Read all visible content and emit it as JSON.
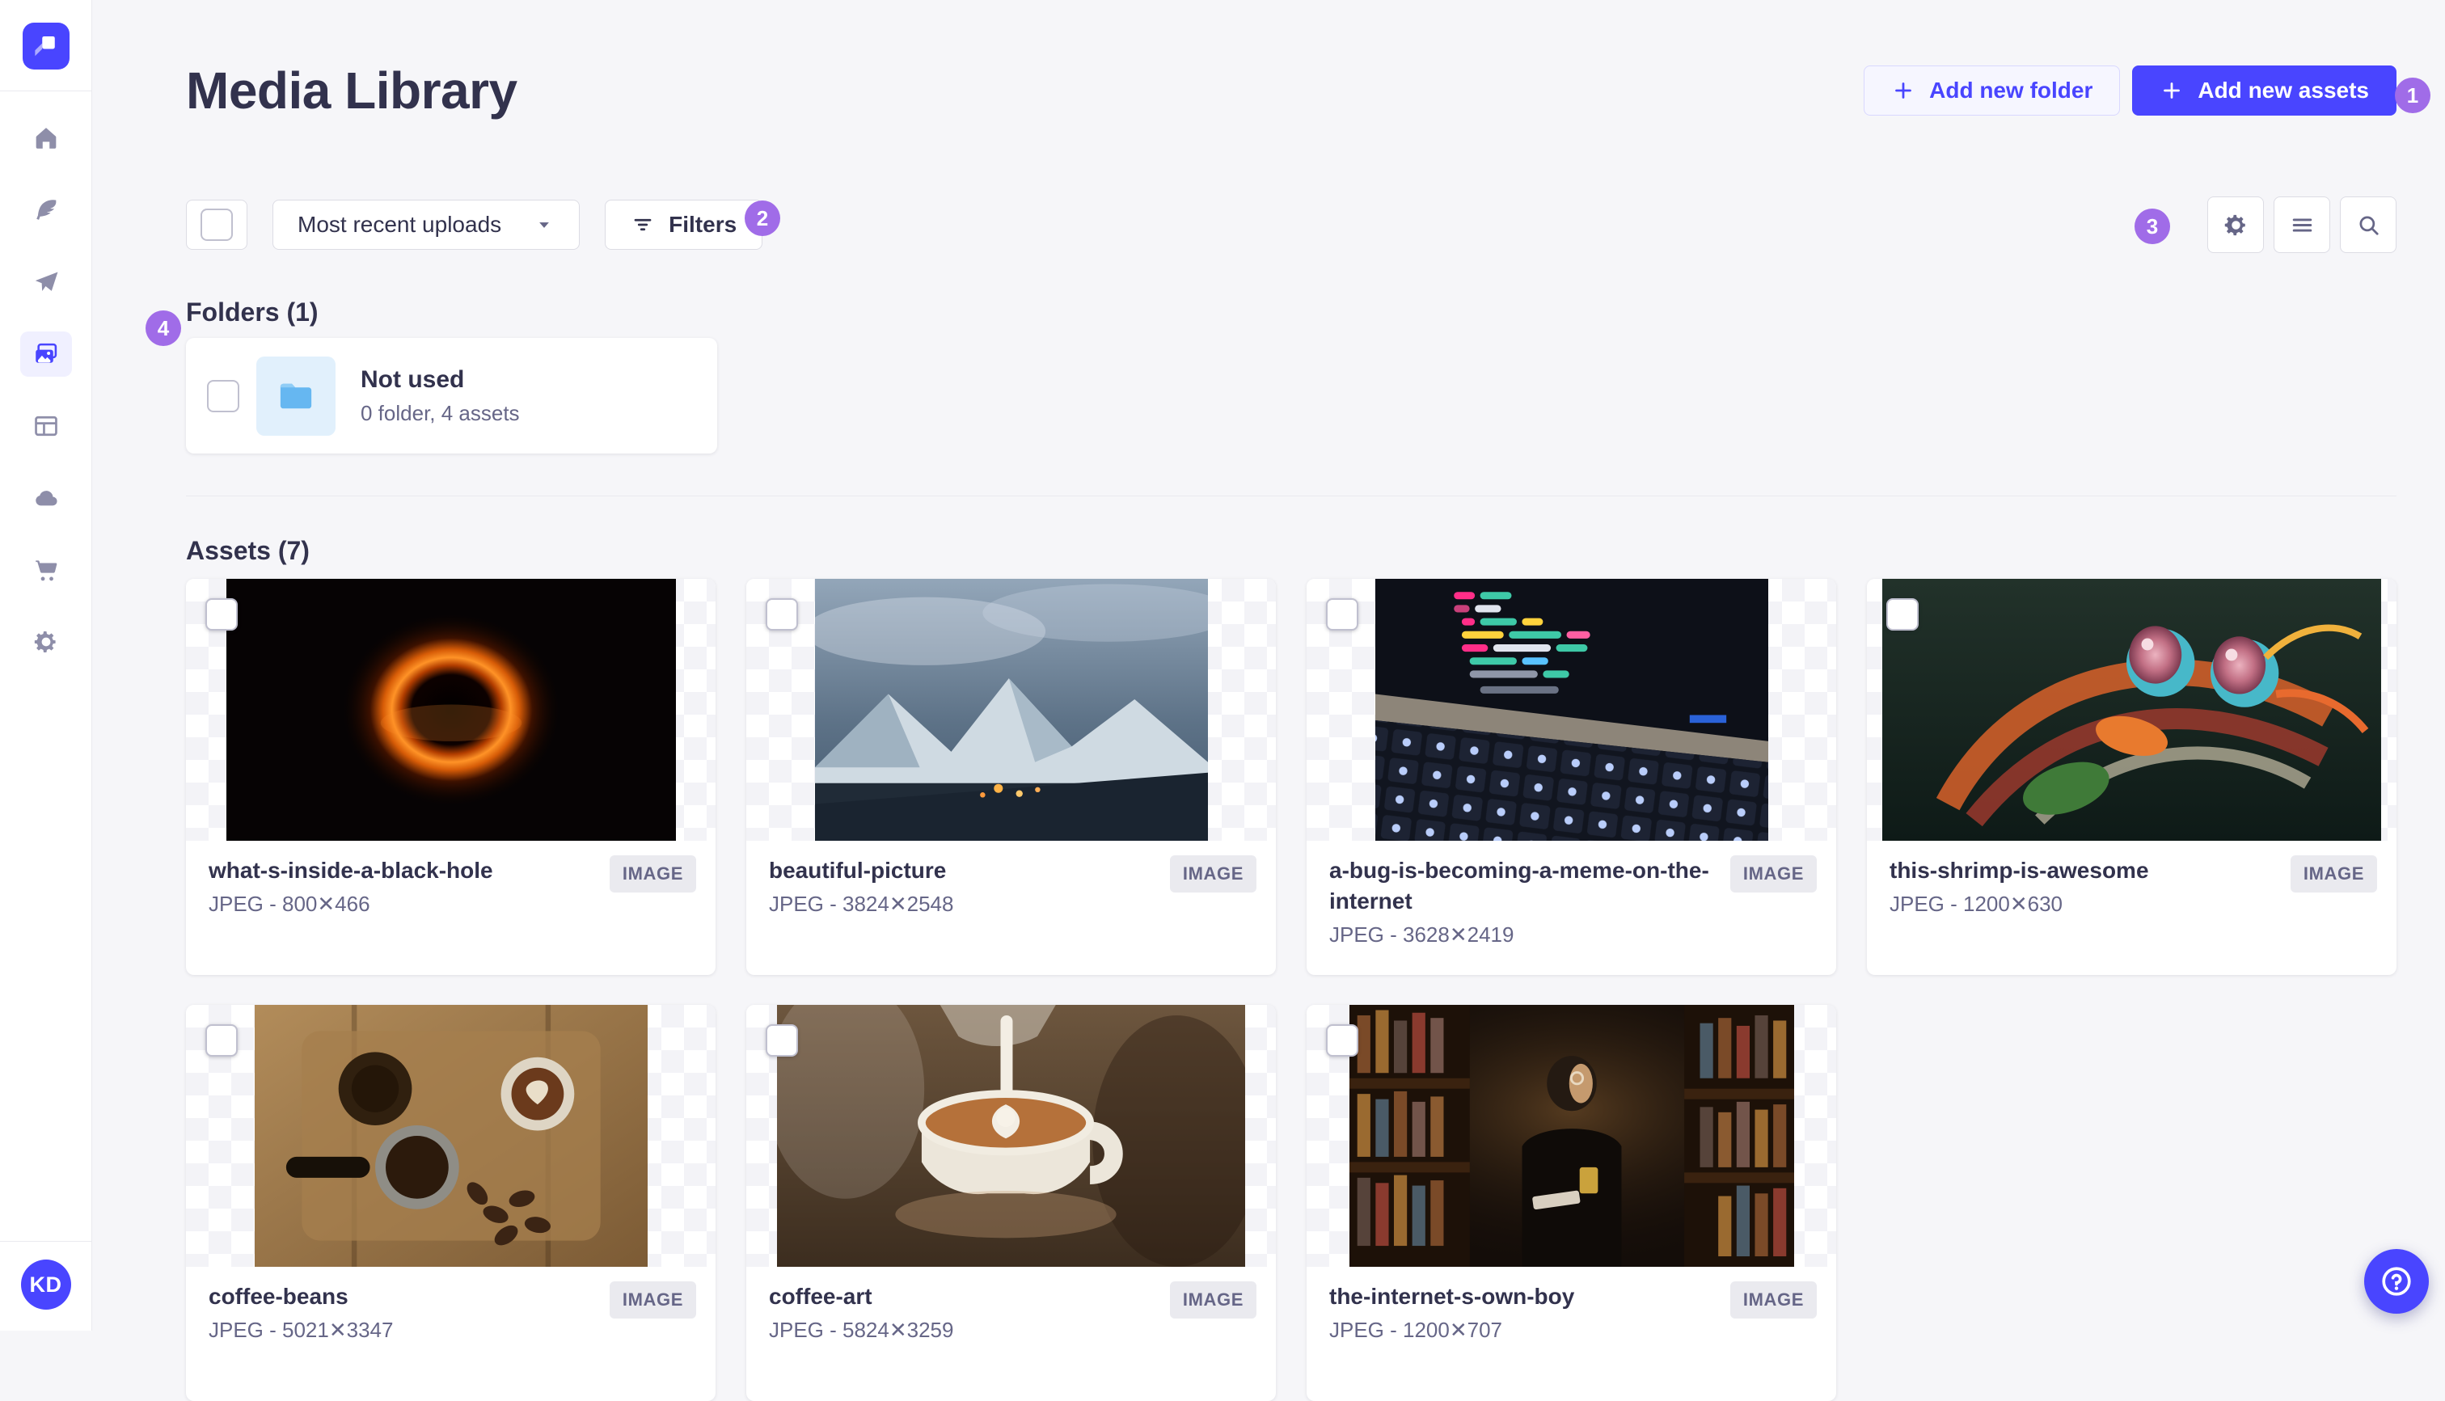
{
  "colors": {
    "accent": "#4945ff",
    "annotation_badge": "#a06ce8",
    "folder_icon_blue": "#66b7f1",
    "page_background": "#f6f6f9"
  },
  "sidebar": {
    "logo_icon": "app-logo-icon",
    "items": [
      {
        "icon": "home-icon",
        "active": false
      },
      {
        "icon": "quill-icon",
        "active": false
      },
      {
        "icon": "paper-plane-icon",
        "active": false
      },
      {
        "icon": "media-library-icon",
        "active": true
      },
      {
        "icon": "layout-icon",
        "active": false
      },
      {
        "icon": "cloud-icon",
        "active": false
      },
      {
        "icon": "cart-icon",
        "active": false
      },
      {
        "icon": "settings-icon",
        "active": false
      }
    ]
  },
  "header": {
    "title": "Media Library",
    "add_folder_label": "Add new folder",
    "add_assets_label": "Add new assets"
  },
  "toolbar": {
    "sort_value": "Most recent uploads",
    "filters_label": "Filters",
    "view_icons": [
      "cog-icon",
      "list-icon",
      "search-icon"
    ]
  },
  "annotations": [
    "1",
    "2",
    "3",
    "4"
  ],
  "folders": {
    "heading": "Folders (1)",
    "items": [
      {
        "name": "Not used",
        "meta": "0 folder, 4 assets"
      }
    ]
  },
  "assets": {
    "heading": "Assets (7)",
    "items": [
      {
        "name": "what-s-inside-a-black-hole",
        "meta": "JPEG - 800✕466",
        "type_badge": "IMAGE",
        "art": "blackhole"
      },
      {
        "name": "beautiful-picture",
        "meta": "JPEG - 3824✕2548",
        "type_badge": "IMAGE",
        "art": "mountain"
      },
      {
        "name": "a-bug-is-becoming-a-meme-on-the-internet",
        "meta": "JPEG - 3628✕2419",
        "type_badge": "IMAGE",
        "art": "code"
      },
      {
        "name": "this-shrimp-is-awesome",
        "meta": "JPEG - 1200✕630",
        "type_badge": "IMAGE",
        "art": "shrimp"
      },
      {
        "name": "coffee-beans",
        "meta": "JPEG - 5021✕3347",
        "type_badge": "IMAGE",
        "art": "beans"
      },
      {
        "name": "coffee-art",
        "meta": "JPEG - 5824✕3259",
        "type_badge": "IMAGE",
        "art": "latte"
      },
      {
        "name": "the-internet-s-own-boy",
        "meta": "JPEG - 1200✕707",
        "type_badge": "IMAGE",
        "art": "library"
      }
    ]
  },
  "user": {
    "initials": "KD"
  },
  "help": {
    "icon": "question-icon"
  }
}
